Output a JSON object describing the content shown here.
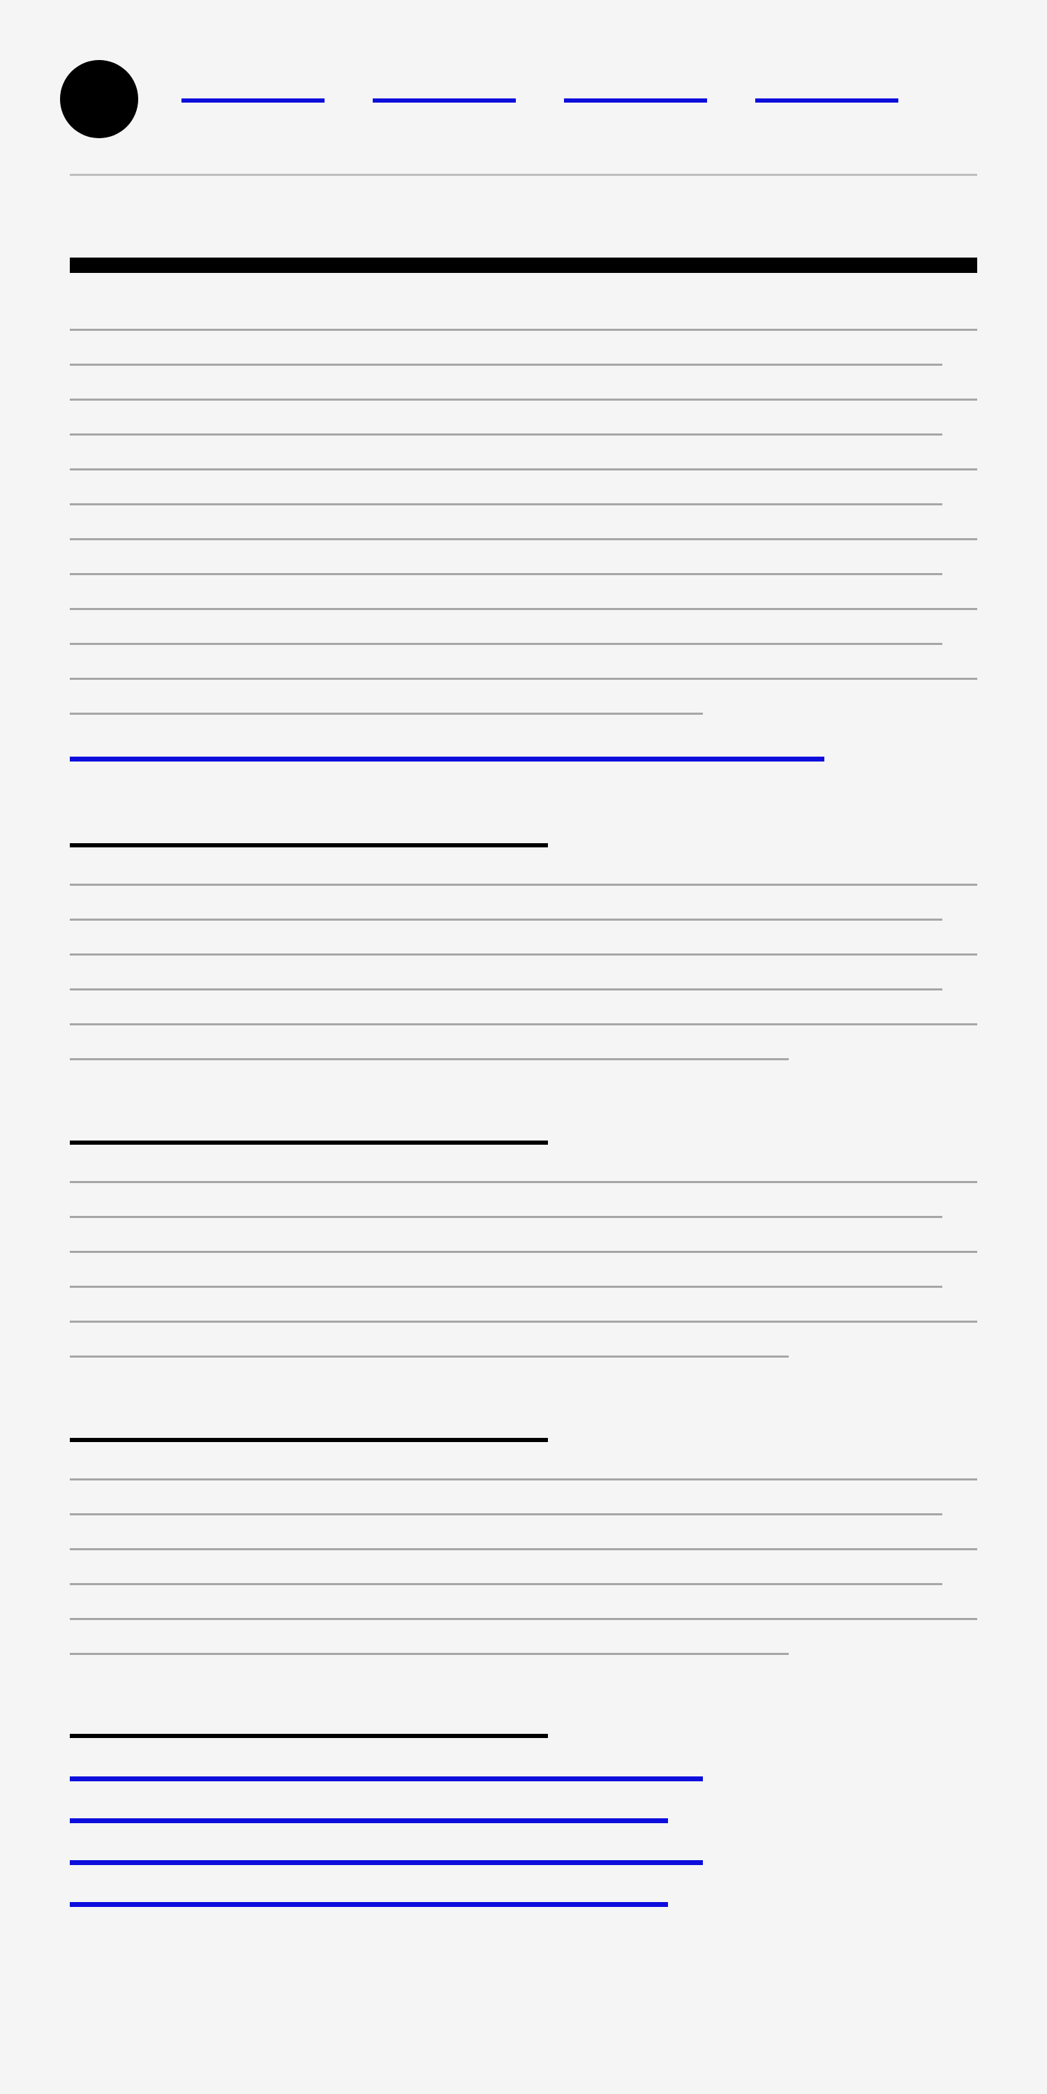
{
  "header": {
    "logo": "circle-logo",
    "nav_links": [
      "",
      "",
      "",
      ""
    ]
  },
  "article": {
    "title": "",
    "intro_paragraph_lines": 12,
    "primary_link": "",
    "sections": [
      {
        "heading": "",
        "body_lines": 6
      },
      {
        "heading": "",
        "body_lines": 6
      },
      {
        "heading": "",
        "body_lines": 6
      }
    ],
    "related": {
      "heading": "",
      "links": [
        "",
        "",
        "",
        ""
      ]
    }
  },
  "colors": {
    "background": "#f4f5f4",
    "link": "#0d0ddc",
    "heading": "#000000",
    "text_placeholder": "#a6a6a6",
    "rule": "#bfbfbf"
  }
}
